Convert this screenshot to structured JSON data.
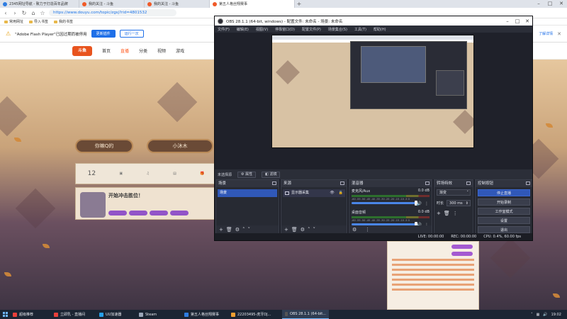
{
  "browser": {
    "tabs": [
      {
        "label": "2345网址导航 - 致力于打造百年品牌",
        "color": "#2f7de1",
        "active": false
      },
      {
        "label": "我的关注 - 斗鱼",
        "color": "#f05a28",
        "active": false
      },
      {
        "label": "我的关注 - 斗鱼",
        "color": "#f05a28",
        "active": false
      },
      {
        "label": "第五人格丝翔赛事",
        "color": "#f05a28",
        "active": true
      }
    ],
    "url": "https://www.douyu.com/topic/zgsj?rid=4801532",
    "bookmarks": [
      "常用网址",
      "导入书签",
      "我的书签"
    ],
    "flash_bar": {
      "message": "\"Adobe Flash Player\"已因过期而被停用",
      "primary_button": "更新插件",
      "secondary_button": "运行一次",
      "help_link": "了解详情"
    },
    "site_nav": [
      "首页",
      "直播",
      "分类",
      "视频",
      "游戏"
    ],
    "logo": "斗鱼",
    "page": {
      "pill_left": "你嘛Q的",
      "pill_right": "小沐木",
      "tab_count": "12",
      "announce_title": "开始冲击胜位！"
    }
  },
  "obs": {
    "title": "OBS 28.1.1 (64-bit, windows) - 配置文件: 未命名 - 场景: 未命名",
    "menu": [
      "文件(F)",
      "编辑(E)",
      "视图(V)",
      "停靠窗口(D)",
      "配置文件(P)",
      "场景集合(S)",
      "工具(T)",
      "帮助(H)"
    ],
    "source_bar": {
      "label": "未选择源",
      "properties": "属性",
      "filters": "滤镜"
    },
    "docks": {
      "scenes": {
        "title": "场景",
        "items": [
          "场景"
        ]
      },
      "sources": {
        "title": "来源",
        "items": [
          "显示器采集"
        ]
      },
      "mixer": {
        "title": "混音器",
        "channels": [
          {
            "name": "麦克风/Aux",
            "db": "0.0 dB"
          },
          {
            "name": "桌面音频",
            "db": "0.0 dB"
          }
        ],
        "ticks": "-60 -55 -50 -45 -40 -35 -30 -25 -20 -15 -10 -5 0"
      },
      "transitions": {
        "title": "转场特效",
        "type": "渐变",
        "duration_label": "时长",
        "duration": "300 ms"
      },
      "controls": {
        "title": "控制按钮",
        "buttons": [
          "停止直播",
          "开始录制",
          "工作室模式",
          "设置",
          "退出"
        ]
      }
    },
    "status": {
      "live": "LIVE: 00:00:00",
      "rec": "REC: 00:00:00",
      "cpu": "CPU: 0.4%, 60.00 fps"
    }
  },
  "taskbar": {
    "items": [
      {
        "label": "超级推荐",
        "color": "#e8403a"
      },
      {
        "label": "立即乳 - 直播间",
        "color": "#e8403a"
      },
      {
        "label": "UU加速器",
        "color": "#26a0e8"
      },
      {
        "label": "Steam",
        "color": "#9aa6b8"
      },
      {
        "label": "第五人格丝翔赛事",
        "color": "#2f7de1"
      },
      {
        "label": "22203495-虎牙DJ...",
        "color": "#f0a030"
      },
      {
        "label": "OBS 28.1.1 (64-bit...",
        "color": "#555"
      }
    ],
    "clock": "19:02"
  }
}
